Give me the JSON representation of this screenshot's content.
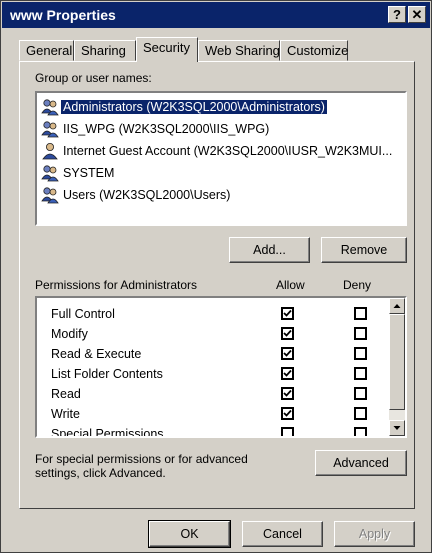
{
  "window": {
    "title": "www Properties",
    "help_label": "?",
    "close_label": "✕"
  },
  "tabs": [
    {
      "label": "General"
    },
    {
      "label": "Sharing"
    },
    {
      "label": "Security"
    },
    {
      "label": "Web Sharing"
    },
    {
      "label": "Customize"
    }
  ],
  "groups": {
    "label": "Group or user names:",
    "items": [
      {
        "label": "Administrators (W2K3SQL2000\\Administrators)",
        "icon": "user-group-icon",
        "selected": true
      },
      {
        "label": "IIS_WPG (W2K3SQL2000\\IIS_WPG)",
        "icon": "user-group-icon"
      },
      {
        "label": "Internet Guest Account (W2K3SQL2000\\IUSR_W2K3MUI...",
        "icon": "user-icon"
      },
      {
        "label": "SYSTEM",
        "icon": "user-group-icon"
      },
      {
        "label": "Users (W2K3SQL2000\\Users)",
        "icon": "user-group-icon"
      }
    ]
  },
  "buttons": {
    "add": "Add...",
    "remove": "Remove",
    "advanced": "Advanced",
    "ok": "OK",
    "cancel": "Cancel",
    "apply": "Apply"
  },
  "permissions": {
    "label": "Permissions for Administrators",
    "allow_header": "Allow",
    "deny_header": "Deny",
    "rows": [
      {
        "name": "Full Control",
        "allow": true,
        "deny": false
      },
      {
        "name": "Modify",
        "allow": true,
        "deny": false
      },
      {
        "name": "Read & Execute",
        "allow": true,
        "deny": false
      },
      {
        "name": "List Folder Contents",
        "allow": true,
        "deny": false
      },
      {
        "name": "Read",
        "allow": true,
        "deny": false
      },
      {
        "name": "Write",
        "allow": true,
        "deny": false
      },
      {
        "name": "Special Permissions",
        "allow": false,
        "deny": false
      }
    ]
  },
  "advanced_note": "For special permissions or for advanced settings, click Advanced."
}
